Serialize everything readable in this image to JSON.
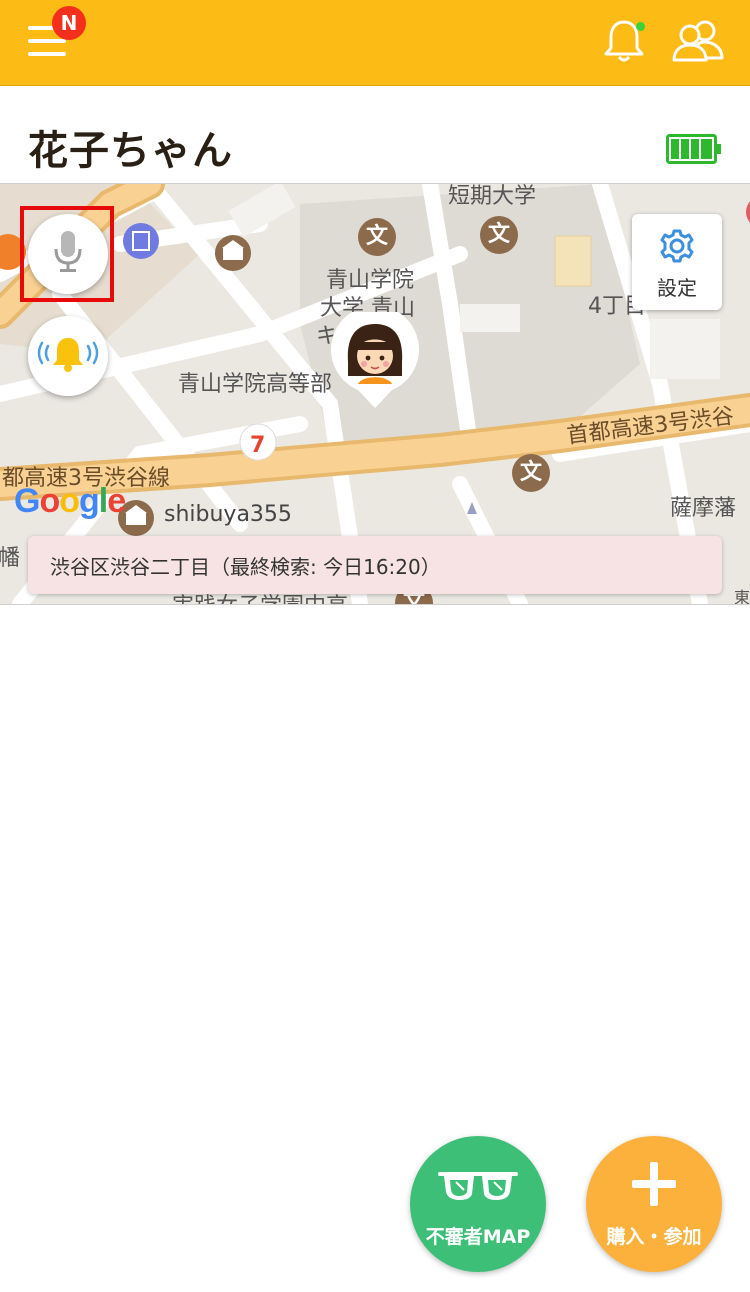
{
  "header": {
    "menu_badge": "N",
    "icons": [
      "menu-icon",
      "bell-icon",
      "users-icon"
    ],
    "bell_dot_color": "#3ed13a",
    "bar_color": "#fcbb15"
  },
  "child": {
    "name": "花子ちゃん",
    "battery_icon": "battery-full-icon",
    "battery_color": "#2eb82e"
  },
  "map": {
    "labels": {
      "university_top": "短期大学",
      "aoyama_1": "青山学院",
      "aoyama_2": "大学 青山",
      "aoyama_3": "キ",
      "aoyama_high": "青山学院高等部",
      "expressway_right": "首都高速3号渋谷",
      "expressway_left": "都高速3号渋谷線",
      "shibuya355": "shibuya355",
      "satsuma": "薩摩藩",
      "jissen": "実践女子学園中高",
      "block_4": "4丁目",
      "hata": "幡",
      "higashi": "東",
      "school_mark": "文",
      "google": "Google"
    },
    "settings_label": "設定",
    "address": "渋谷区渋谷二丁目（最終検索: 今日16:20）",
    "buttons": [
      "microphone-icon",
      "alarm-bell-icon",
      "gear-icon"
    ]
  },
  "fabs": {
    "suspicious_map": "不審者MAP",
    "purchase": "購入・参加",
    "suspicious_color": "#3dbf78",
    "purchase_color": "#fcb13c"
  }
}
